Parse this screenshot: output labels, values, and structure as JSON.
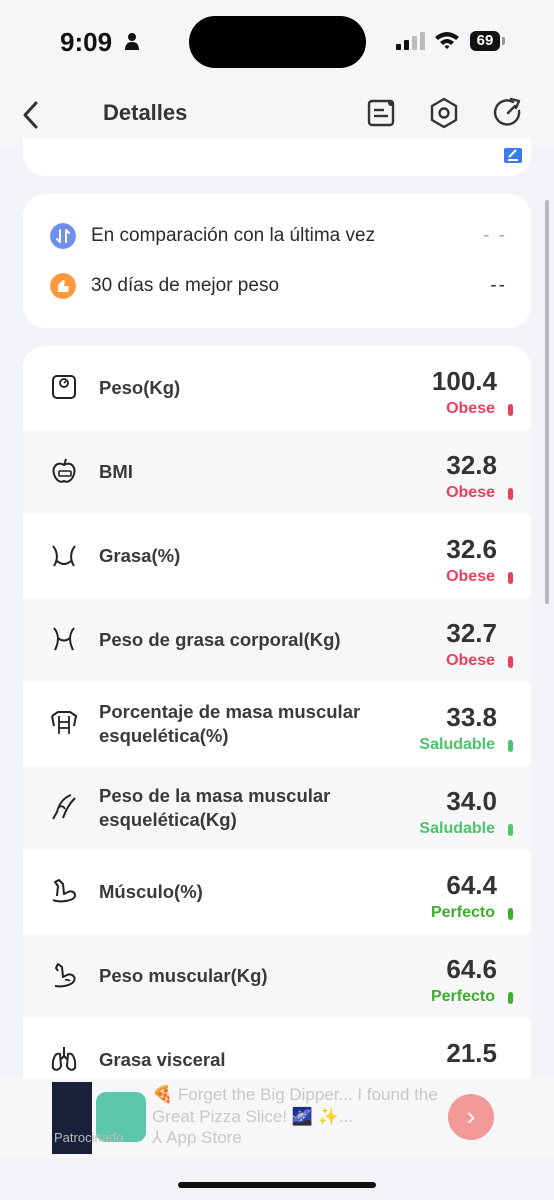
{
  "status_bar": {
    "time": "9:09",
    "battery": "69"
  },
  "header": {
    "title": "Detalles"
  },
  "comparison": [
    {
      "label": "En comparación con la última vez",
      "value": "- -",
      "icon": "compare-arrows-icon",
      "color": "#6a8cff"
    },
    {
      "label": "30 días de mejor peso",
      "value": "--",
      "icon": "thumbs-up-icon",
      "color": "#ff9a3c"
    }
  ],
  "metrics": [
    {
      "label": "Peso(Kg)",
      "value": "100.4",
      "status": "Obese",
      "status_color": "#e8415e",
      "icon": "scale-icon"
    },
    {
      "label": "BMI",
      "value": "32.8",
      "status": "Obese",
      "status_color": "#e8415e",
      "icon": "apple-scale-icon"
    },
    {
      "label": "Grasa(%)",
      "value": "32.6",
      "status": "Obese",
      "status_color": "#e8415e",
      "icon": "waist-icon"
    },
    {
      "label": "Peso de grasa corporal(Kg)",
      "value": "32.7",
      "status": "Obese",
      "status_color": "#e8415e",
      "icon": "body-fat-icon"
    },
    {
      "label": "Porcentaje de masa muscular esquelética(%)",
      "value": "33.8",
      "status": "Saludable",
      "status_color": "#4cc46e",
      "icon": "torso-icon"
    },
    {
      "label": "Peso de la masa muscular esquelética(Kg)",
      "value": "34.0",
      "status": "Saludable",
      "status_color": "#4cc46e",
      "icon": "leg-icon"
    },
    {
      "label": "Músculo(%)",
      "value": "64.4",
      "status": "Perfecto",
      "status_color": "#3cae2c",
      "icon": "bicep-icon"
    },
    {
      "label": "Peso muscular(Kg)",
      "value": "64.6",
      "status": "Perfecto",
      "status_color": "#3cae2c",
      "icon": "arm-muscle-icon"
    },
    {
      "label": "Grasa visceral",
      "value": "21.5",
      "status": "",
      "status_color": "#e8415e",
      "icon": "lungs-icon"
    }
  ],
  "ad": {
    "text": "🍕 Forget the Big Dipper... I found the Great Pizza Slice! 🌌 ✨...",
    "store": "App Store",
    "sponsored": "Patrocinado"
  }
}
